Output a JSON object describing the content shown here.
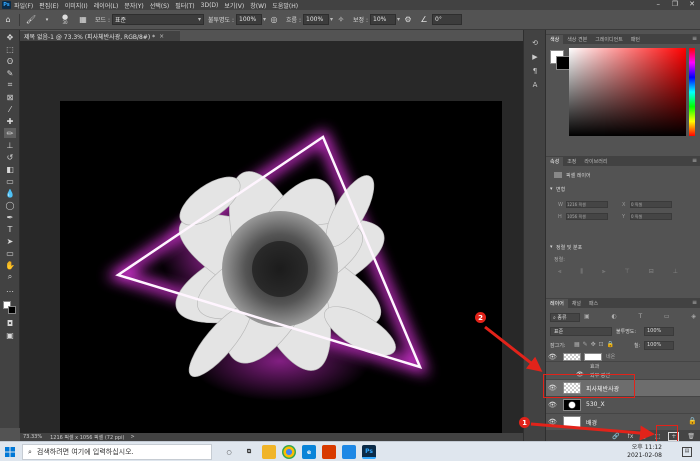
{
  "menubar": {
    "app_logo": "Ps",
    "items": [
      "파일(F)",
      "편집(E)",
      "이미지(I)",
      "레이어(L)",
      "문자(Y)",
      "선택(S)",
      "필터(T)",
      "3D(D)",
      "보기(V)",
      "창(W)",
      "도움말(H)"
    ],
    "window_controls": [
      "–",
      "❐",
      "✕"
    ]
  },
  "options": {
    "brush_size": "30",
    "mode_label": "모드 :",
    "mode_value": "표준",
    "opacity_label": "불투명도 :",
    "opacity_value": "100%",
    "flow_label": "흐름 :",
    "flow_value": "100%",
    "smoothing_label": "보정 :",
    "smoothing_value": "10%",
    "angle_value": "0°"
  },
  "document": {
    "tab_title": "제목 없음-1 @ 73.3% (피사체반사광, RGB/8#) *",
    "close": "×"
  },
  "status": {
    "zoom": "73.33%",
    "doc_info": "1216 픽셀 x 1056 픽셀 (72 ppi)",
    "arrow": ">"
  },
  "panels": {
    "color_tabs": [
      "색상",
      "색상 견본",
      "그레이디언트",
      "패턴"
    ],
    "props_tabs": [
      "속성",
      "조정",
      "라이브러리"
    ],
    "props_kind": "픽셀 레이어",
    "transform_label": "변형",
    "transform_fields": [
      {
        "label": "W",
        "value": "1216 픽셀"
      },
      {
        "label": "H",
        "value": "1056 픽셀"
      },
      {
        "label": "X",
        "value": "0 픽셀"
      },
      {
        "label": "Y",
        "value": "0 픽셀"
      }
    ],
    "align_label": "정렬 및 분포",
    "align_sub": "정렬:",
    "layers_tabs": [
      "레이어",
      "채널",
      "패스"
    ],
    "filter_kind": "종류",
    "blend_mode": "표준",
    "opacity_label": "불투명도:",
    "opacity_value": "100%",
    "lock_label": "잠그기:",
    "fill_label": "칠:",
    "fill_value": "100%",
    "layers": [
      {
        "name": "네온",
        "selected": false,
        "visible": true
      },
      {
        "name": "효과",
        "selected": false,
        "visible": false
      },
      {
        "name": "외부 광선",
        "selected": false,
        "visible": true
      },
      {
        "name": "피사체반사광",
        "selected": true,
        "visible": true
      },
      {
        "name": "530_X",
        "selected": false,
        "visible": true
      },
      {
        "name": "배경",
        "selected": false,
        "visible": true
      }
    ],
    "bottom_icons": [
      "🔗",
      "fx",
      "◐",
      "⬚",
      "+",
      "🗑"
    ]
  },
  "annotations": [
    {
      "number": "1"
    },
    {
      "number": "2"
    }
  ],
  "taskbar": {
    "search_placeholder": "검색하려면 여기에 입력하십시오.",
    "time": "오후 11:12",
    "date": "2021-02-08",
    "apps": [
      "Ps"
    ]
  },
  "colors": {
    "accent_red": "#e2231a",
    "ps_blue": "#31a8ff",
    "neon_magenta": "#ff3cff"
  }
}
